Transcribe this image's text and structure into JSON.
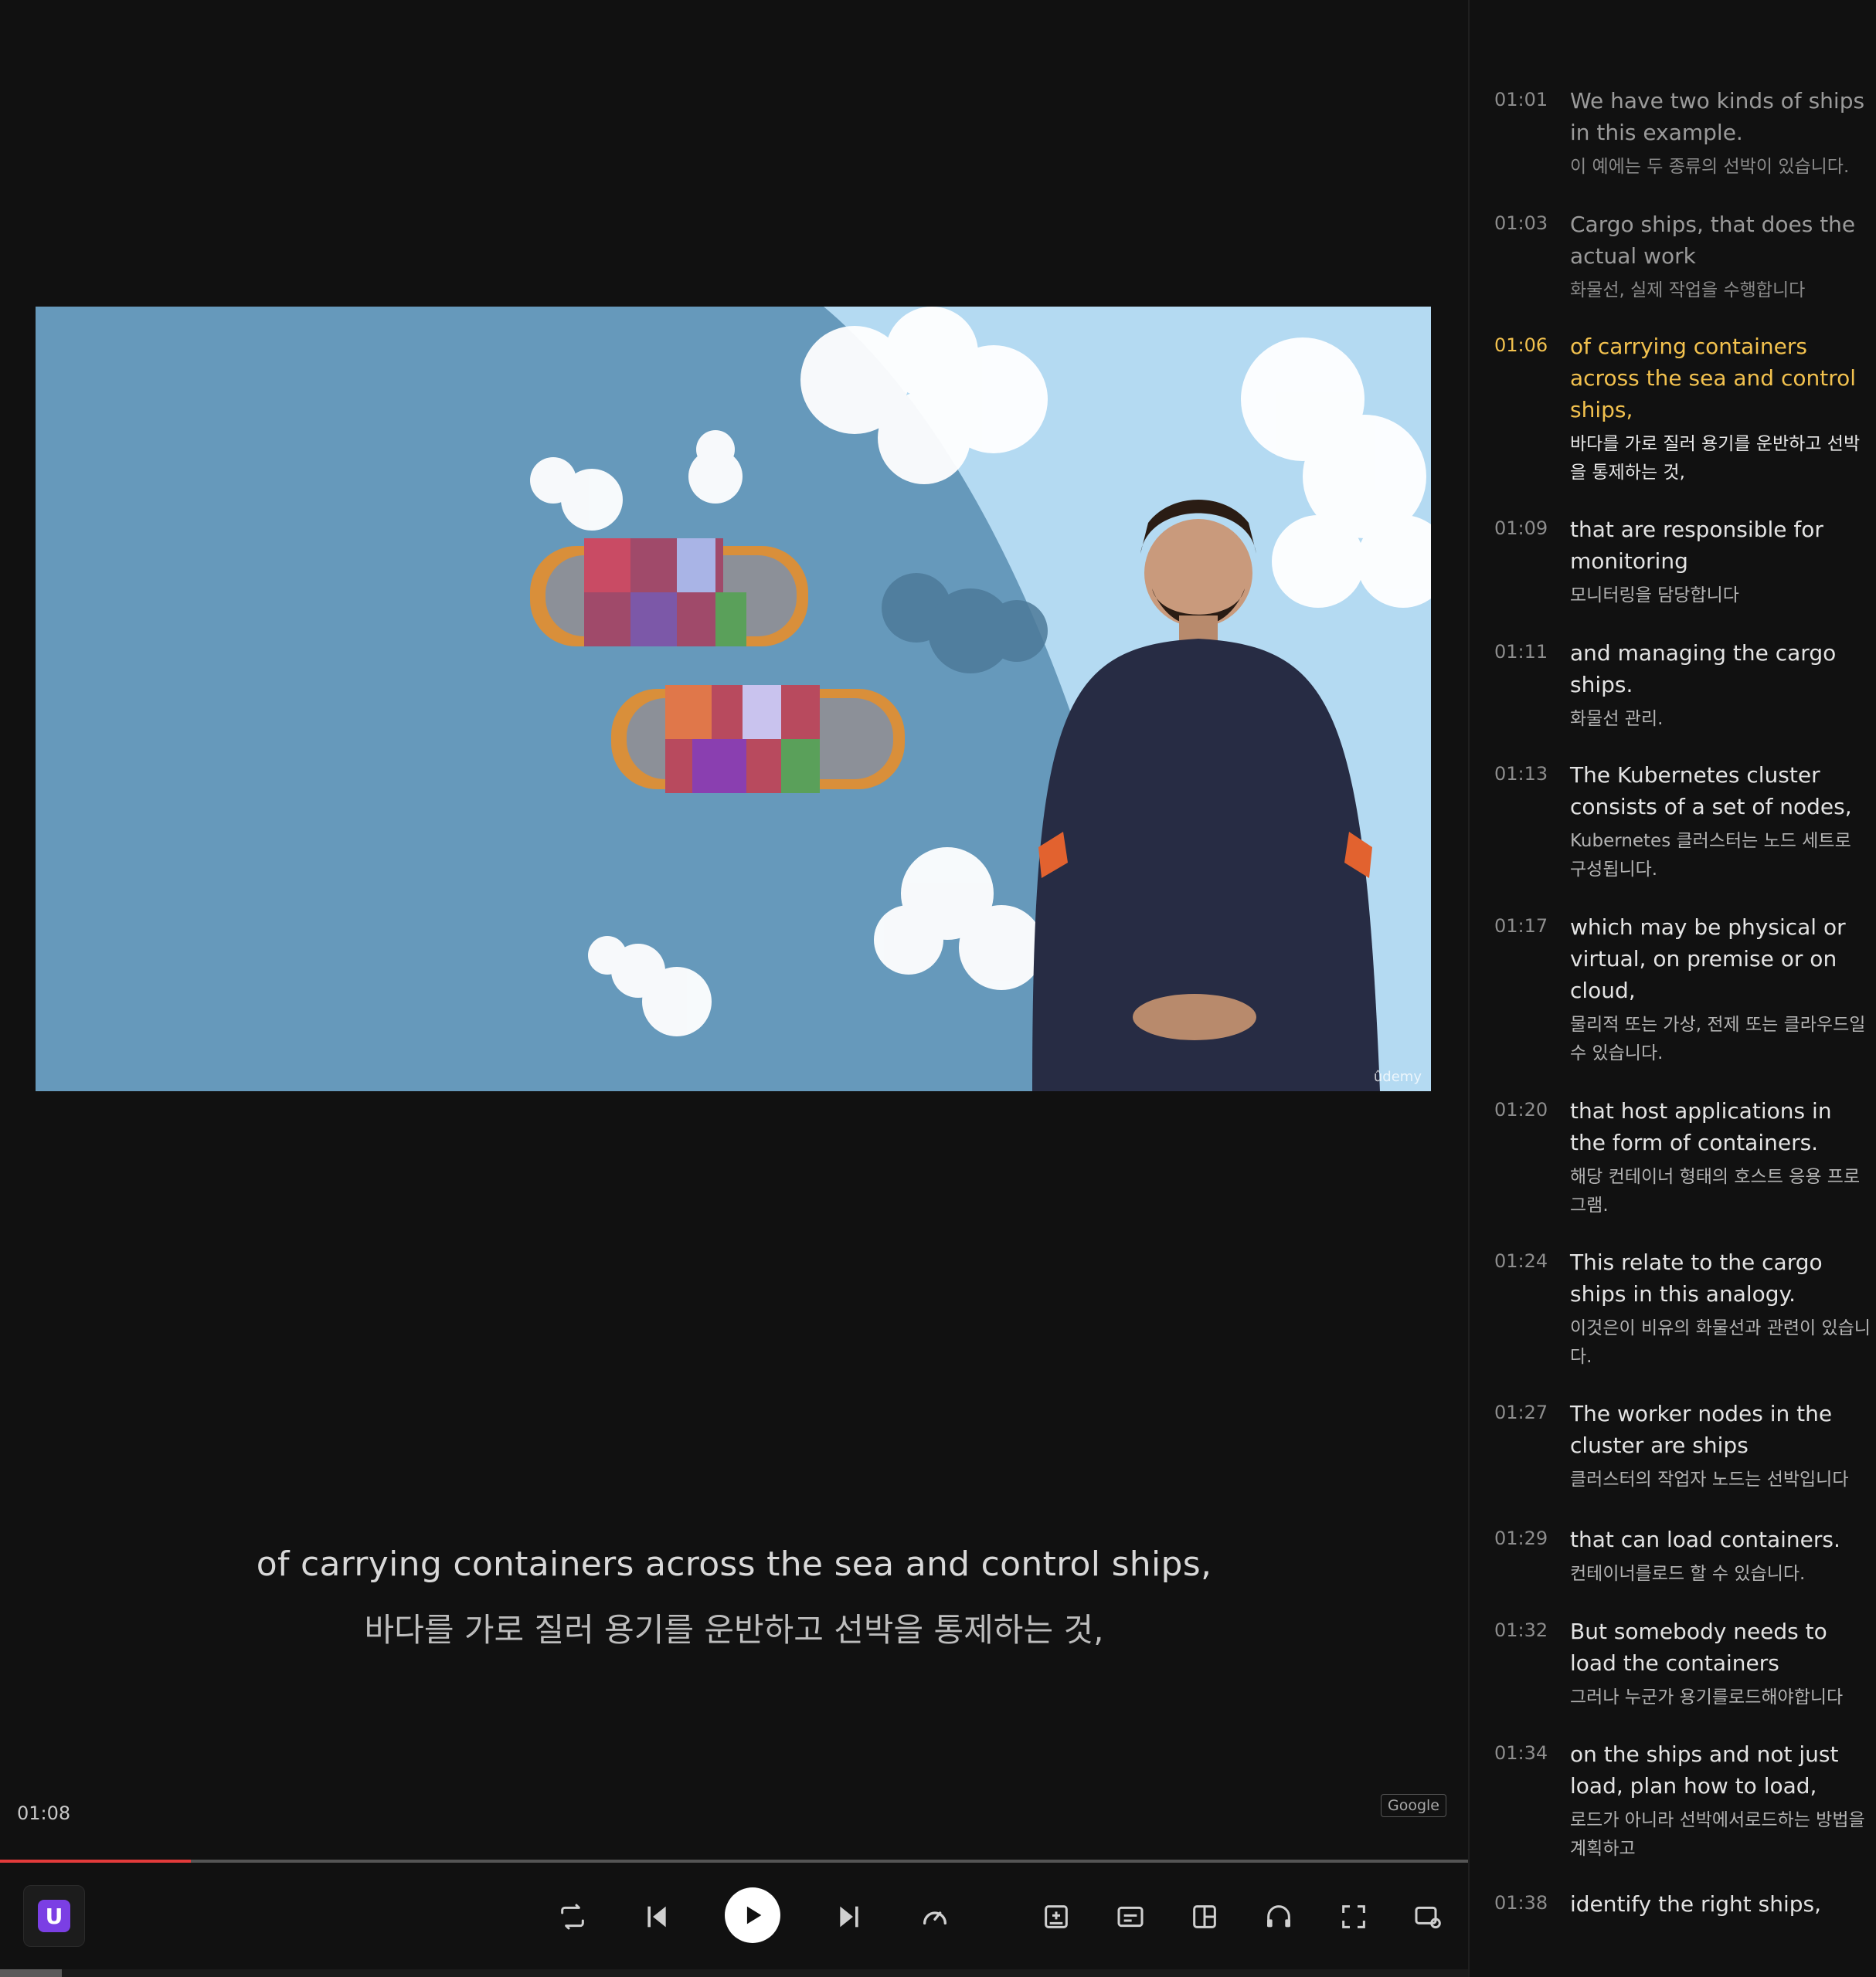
{
  "video": {
    "watermark": "ûdemy"
  },
  "captions": {
    "english": "of carrying containers across the sea and control ships,",
    "korean": "바다를 가로 질러 용기를 운반하고 선박을 통제하는 것,"
  },
  "player": {
    "current_time": "01:08",
    "translation_badge": "Google",
    "progress_fraction": 0.13
  },
  "controls": {
    "extension_logo": "U",
    "icons": [
      "loop-icon",
      "previous-icon",
      "play-icon",
      "next-icon",
      "speed-icon",
      "add-note-icon",
      "subtitles-icon",
      "layout-icon",
      "audio-icon",
      "fullscreen-icon",
      "settings-icon"
    ]
  },
  "transcript": {
    "cues": [
      {
        "time": "01:01",
        "en": "We have two kinds of ships in this example.",
        "ko": "이 예에는 두 종류의 선박이 있습니다.",
        "state": "past"
      },
      {
        "time": "01:03",
        "en": "Cargo ships, that does the actual work",
        "ko": "화물선, 실제 작업을 수행합니다",
        "state": "past"
      },
      {
        "time": "01:06",
        "en": "of carrying containers across the sea and control ships,",
        "ko": "바다를 가로 질러 용기를 운반하고 선박을 통제하는 것,",
        "state": "active"
      },
      {
        "time": "01:09",
        "en": "that are responsible for monitoring",
        "ko": "모니터링을 담당합니다",
        "state": "future"
      },
      {
        "time": "01:11",
        "en": "and managing the cargo ships.",
        "ko": "화물선 관리.",
        "state": "future"
      },
      {
        "time": "01:13",
        "en": "The Kubernetes cluster consists of a set of nodes,",
        "ko": "Kubernetes 클러스터는 노드 세트로 구성됩니다.",
        "state": "future"
      },
      {
        "time": "01:17",
        "en": "which may be physical or virtual, on premise or on cloud,",
        "ko": "물리적 또는 가상, 전제 또는 클라우드일 수 있습니다.",
        "state": "future"
      },
      {
        "time": "01:20",
        "en": "that host applications in the form of containers.",
        "ko": "해당 컨테이너 형태의 호스트 응용 프로그램.",
        "state": "future"
      },
      {
        "time": "01:24",
        "en": "This relate to the cargo ships in this analogy.",
        "ko": "이것은이 비유의 화물선과 관련이 있습니다.",
        "state": "future"
      },
      {
        "time": "01:27",
        "en": "The worker nodes in the cluster are ships",
        "ko": "클러스터의 작업자 노드는 선박입니다",
        "state": "future"
      },
      {
        "time": "01:29",
        "en": "that can load containers.",
        "ko": "컨테이너를로드 할 수 있습니다.",
        "state": "future"
      },
      {
        "time": "01:32",
        "en": "But somebody needs to load the containers",
        "ko": "그러나 누군가 용기를로드해야합니다",
        "state": "future"
      },
      {
        "time": "01:34",
        "en": "on the ships and not just load, plan how to load,",
        "ko": "로드가 아니라 선박에서로드하는 방법을 계획하고",
        "state": "future"
      },
      {
        "time": "01:38",
        "en": "identify the right ships,",
        "ko": "",
        "state": "future"
      }
    ]
  }
}
